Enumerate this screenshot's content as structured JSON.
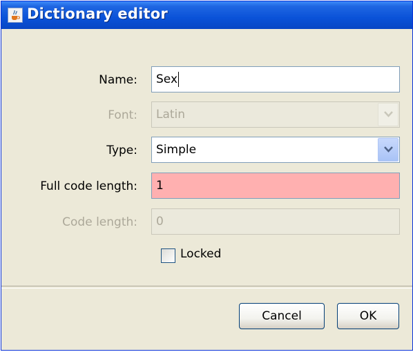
{
  "window": {
    "title": "Dictionary editor"
  },
  "form": {
    "name": {
      "label": "Name:",
      "value": "Sex"
    },
    "font": {
      "label": "Font:",
      "value": "Latin"
    },
    "type": {
      "label": "Type:",
      "value": "Simple"
    },
    "full_code_length": {
      "label": "Full code length:",
      "value": "1"
    },
    "code_length": {
      "label": "Code length:",
      "value": "0"
    },
    "locked": {
      "label": "Locked",
      "checked": false
    }
  },
  "buttons": {
    "cancel": "Cancel",
    "ok": "OK"
  },
  "colors": {
    "title_bar": "#0a52d8",
    "error_field": "#ffb0b0",
    "dialog_bg": "#ece9d8"
  },
  "icons": {
    "app": "java-cup-icon",
    "dropdown": "chevron-down-icon"
  }
}
